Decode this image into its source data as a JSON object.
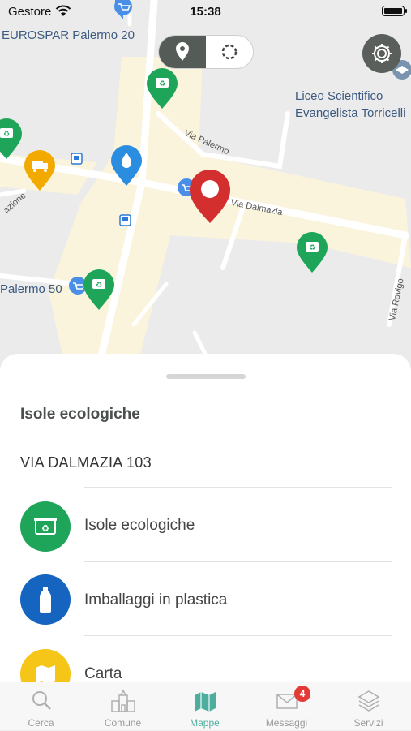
{
  "status_bar": {
    "carrier": "Gestore",
    "time": "15:38"
  },
  "map": {
    "poi_labels": {
      "eurospar": "EUROSPAR Palermo 20",
      "liceo_line1": "Liceo Scientifico",
      "liceo_line2": "Evangelista Torricelli",
      "palermo50": "Palermo 50"
    },
    "streets": {
      "via_palermo": "Via Palermo",
      "via_dalmazia": "Via Dalmazia",
      "via_rovigo": "Via Rovigo",
      "stazione": "azione"
    },
    "segment": {
      "left_icon": "location-pin-icon",
      "right_icon": "refresh-ring-icon",
      "selected": "left"
    },
    "settings_icon": "gear-icon"
  },
  "sheet": {
    "title": "Isole ecologiche",
    "address": "VIA DALMAZIA 103",
    "items": [
      {
        "label": "Isole ecologiche",
        "color": "#1fa55a",
        "icon": "recycle-bin-icon"
      },
      {
        "label": "Imballaggi in plastica",
        "color": "#1565c0",
        "icon": "plastic-bottle-icon"
      },
      {
        "label": "Carta",
        "color": "#f5c518",
        "icon": "paper-map-icon"
      }
    ]
  },
  "tabbar": {
    "tabs": [
      {
        "label": "Cerca",
        "icon": "search-icon"
      },
      {
        "label": "Comune",
        "icon": "town-hall-icon"
      },
      {
        "label": "Mappe",
        "icon": "map-icon",
        "active": true
      },
      {
        "label": "Messaggi",
        "icon": "envelope-icon",
        "badge": "4"
      },
      {
        "label": "Servizi",
        "icon": "layers-icon"
      }
    ]
  },
  "colors": {
    "accent": "#4caf9e",
    "green_marker": "#1fa55a",
    "red_marker": "#d32f2f",
    "yellow_marker": "#f2a900",
    "blue_marker": "#2a7ad8"
  }
}
